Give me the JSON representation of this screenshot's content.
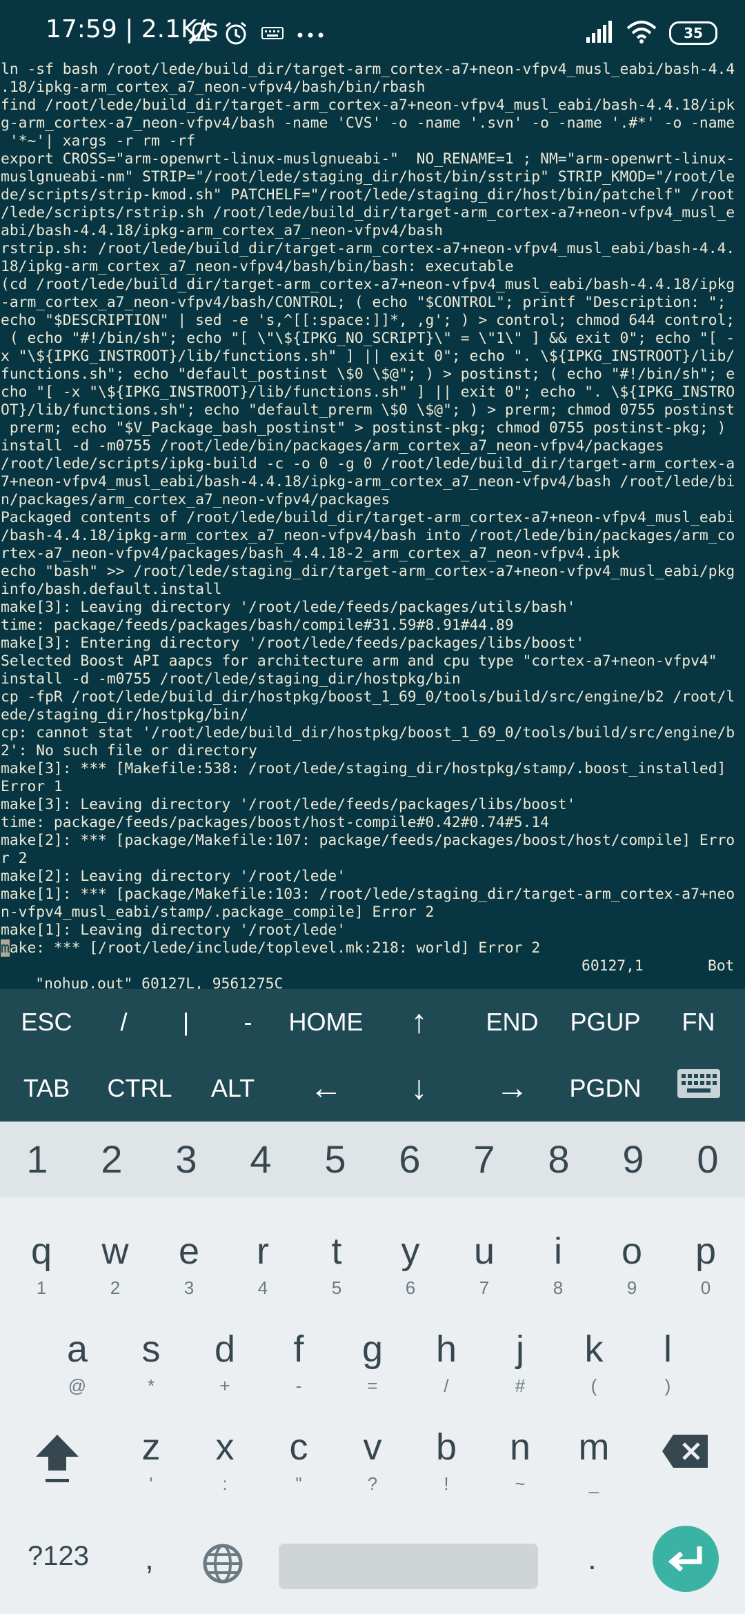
{
  "status_bar": {
    "time": "17:59 | 2.1K/s",
    "battery": "35",
    "icons": [
      "mute-bell-icon",
      "alarm-icon",
      "keyboard-icon",
      "more-icon",
      "signal-icon",
      "wifi-icon",
      "battery-icon"
    ]
  },
  "terminal": {
    "lines": [
      "ln -sf bash /root/lede/build_dir/target-arm_cortex-a7+neon-vfpv4_musl_eabi/bash-4.4",
      ".18/ipkg-arm_cortex_a7_neon-vfpv4/bash/bin/rbash",
      "find /root/lede/build_dir/target-arm_cortex-a7+neon-vfpv4_musl_eabi/bash-4.4.18/ipk",
      "g-arm_cortex-a7_neon-vfpv4/bash -name 'CVS' -o -name '.svn' -o -name '.#*' -o -name",
      " '*~'| xargs -r rm -rf",
      "export CROSS=\"arm-openwrt-linux-muslgnueabi-\"  NO_RENAME=1 ; NM=\"arm-openwrt-linux-",
      "muslgnueabi-nm\" STRIP=\"/root/lede/staging_dir/host/bin/sstrip\" STRIP_KMOD=\"/root/le",
      "de/scripts/strip-kmod.sh\" PATCHELF=\"/root/lede/staging_dir/host/bin/patchelf\" /root",
      "/lede/scripts/rstrip.sh /root/lede/build_dir/target-arm_cortex-a7+neon-vfpv4_musl_e",
      "abi/bash-4.4.18/ipkg-arm_cortex_a7_neon-vfpv4/bash",
      "rstrip.sh: /root/lede/build_dir/target-arm_cortex-a7+neon-vfpv4_musl_eabi/bash-4.4.",
      "18/ipkg-arm_cortex_a7_neon-vfpv4/bash/bin/bash: executable",
      "(cd /root/lede/build_dir/target-arm_cortex-a7+neon-vfpv4_musl_eabi/bash-4.4.18/ipkg",
      "-arm_cortex_a7_neon-vfpv4/bash/CONTROL; ( echo \"$CONTROL\"; printf \"Description: \";",
      "echo \"$DESCRIPTION\" | sed -e 's,^[[:space:]]*, ,g'; ) > control; chmod 644 control;",
      " ( echo \"#!/bin/sh\"; echo \"[ \\\"\\${IPKG_NO_SCRIPT}\\\" = \\\"1\\\" ] && exit 0\"; echo \"[ -",
      "x \"\\${IPKG_INSTROOT}/lib/functions.sh\" ] || exit 0\"; echo \". \\${IPKG_INSTROOT}/lib/",
      "functions.sh\"; echo \"default_postinst \\$0 \\$@\"; ) > postinst; ( echo \"#!/bin/sh\"; e",
      "cho \"[ -x \"\\${IPKG_INSTROOT}/lib/functions.sh\" ] || exit 0\"; echo \". \\${IPKG_INSTRO",
      "OT}/lib/functions.sh\"; echo \"default_prerm \\$0 \\$@\"; ) > prerm; chmod 0755 postinst",
      " prerm; echo \"$V_Package_bash_postinst\" > postinst-pkg; chmod 0755 postinst-pkg; )",
      "install -d -m0755 /root/lede/bin/packages/arm_cortex_a7_neon-vfpv4/packages",
      "/root/lede/scripts/ipkg-build -c -o 0 -g 0 /root/lede/build_dir/target-arm_cortex-a",
      "7+neon-vfpv4_musl_eabi/bash-4.4.18/ipkg-arm_cortex_a7_neon-vfpv4/bash /root/lede/bi",
      "n/packages/arm_cortex_a7_neon-vfpv4/packages",
      "Packaged contents of /root/lede/build_dir/target-arm_cortex-a7+neon-vfpv4_musl_eabi",
      "/bash-4.4.18/ipkg-arm_cortex_a7_neon-vfpv4/bash into /root/lede/bin/packages/arm_co",
      "rtex-a7_neon-vfpv4/packages/bash_4.4.18-2_arm_cortex_a7_neon-vfpv4.ipk",
      "echo \"bash\" >> /root/lede/staging_dir/target-arm_cortex-a7+neon-vfpv4_musl_eabi/pkg",
      "info/bash.default.install",
      "make[3]: Leaving directory '/root/lede/feeds/packages/utils/bash'",
      "time: package/feeds/packages/bash/compile#31.59#8.91#44.89",
      "make[3]: Entering directory '/root/lede/feeds/packages/libs/boost'",
      "Selected Boost API aapcs for architecture arm and cpu type \"cortex-a7+neon-vfpv4\"",
      "install -d -m0755 /root/lede/staging_dir/hostpkg/bin",
      "cp -fpR /root/lede/build_dir/hostpkg/boost_1_69_0/tools/build/src/engine/b2 /root/l",
      "ede/staging_dir/hostpkg/bin/",
      "cp: cannot stat '/root/lede/build_dir/hostpkg/boost_1_69_0/tools/build/src/engine/b",
      "2': No such file or directory",
      "make[3]: *** [Makefile:538: /root/lede/staging_dir/hostpkg/stamp/.boost_installed]",
      "Error 1",
      "make[3]: Leaving directory '/root/lede/feeds/packages/libs/boost'",
      "time: package/feeds/packages/boost/host-compile#0.42#0.74#5.14",
      "make[2]: *** [package/Makefile:107: package/feeds/packages/boost/host/compile] Erro",
      "r 2",
      "make[2]: Leaving directory '/root/lede'",
      "make[1]: *** [package/Makefile:103: /root/lede/staging_dir/target-arm_cortex-a7+neo",
      "n-vfpv4_musl_eabi/stamp/.package_compile] Error 2",
      "make[1]: Leaving directory '/root/lede'"
    ],
    "cursor_char": "m",
    "last_line_rest": "ake: *** [/root/lede/include/toplevel.mk:218: world] Error 2",
    "vim_status": {
      "file_info": "\"nohup.out\" 60127L, 9561275C",
      "position": "60127,1",
      "scroll": "Bot"
    }
  },
  "extra_keys": {
    "row1": [
      "ESC",
      "/",
      "|",
      "-",
      "HOME",
      "↑",
      "END",
      "PGUP",
      "FN"
    ],
    "row2": [
      "TAB",
      "CTRL",
      "ALT",
      "←",
      "↓",
      "→",
      "PGDN"
    ],
    "keyboard_toggle_icon": "keyboard-icon"
  },
  "keyboard": {
    "numbers": [
      "1",
      "2",
      "3",
      "4",
      "5",
      "6",
      "7",
      "8",
      "9",
      "0"
    ],
    "row1": [
      {
        "key": "q",
        "sub": "1"
      },
      {
        "key": "w",
        "sub": "2"
      },
      {
        "key": "e",
        "sub": "3"
      },
      {
        "key": "r",
        "sub": "4"
      },
      {
        "key": "t",
        "sub": "5"
      },
      {
        "key": "y",
        "sub": "6"
      },
      {
        "key": "u",
        "sub": "7"
      },
      {
        "key": "i",
        "sub": "8"
      },
      {
        "key": "o",
        "sub": "9"
      },
      {
        "key": "p",
        "sub": "0"
      }
    ],
    "row2": [
      {
        "key": "a",
        "sub": "@"
      },
      {
        "key": "s",
        "sub": "*"
      },
      {
        "key": "d",
        "sub": "+"
      },
      {
        "key": "f",
        "sub": "-"
      },
      {
        "key": "g",
        "sub": "="
      },
      {
        "key": "h",
        "sub": "/"
      },
      {
        "key": "j",
        "sub": "#"
      },
      {
        "key": "k",
        "sub": "("
      },
      {
        "key": "l",
        "sub": ")"
      }
    ],
    "row3": [
      {
        "key": "z",
        "sub": "'"
      },
      {
        "key": "x",
        "sub": ":"
      },
      {
        "key": "c",
        "sub": "\""
      },
      {
        "key": "v",
        "sub": "?"
      },
      {
        "key": "b",
        "sub": "!"
      },
      {
        "key": "n",
        "sub": "~"
      },
      {
        "key": "m",
        "sub": "_"
      }
    ],
    "symbols_label": "?123",
    "comma": ",",
    "period": ".",
    "colors": {
      "enter": "#3bb3a4",
      "key_text": "#37474f"
    }
  }
}
